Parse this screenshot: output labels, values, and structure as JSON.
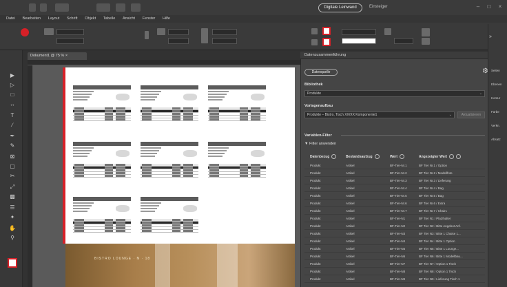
{
  "app": {
    "cloud_button": "Digitale Leinwand",
    "workspace": "Einsteiger"
  },
  "menu": [
    "Datei",
    "Bearbeiten",
    "Layout",
    "Schrift",
    "Objekt",
    "Tabelle",
    "Ansicht",
    "Fenster",
    "Hilfe"
  ],
  "document": {
    "tab_label": "Dokument1 @ 75 % ×"
  },
  "page": {
    "photo_caption": "BISTRO LOUNGE · N · 18"
  },
  "panel": {
    "title": "Datenzusammenführung",
    "action_button": "Datenquelle",
    "source_label": "Bibliothek",
    "source_value": "Produkte",
    "template_label": "Vorlagenaufbau",
    "template_value": "Produkte – Bistro, Tisch XX/XX Komponente1",
    "right_button": "Aktualisieren",
    "filter_label": "Variablen-Filter",
    "filter_toggle": "Filter anwenden",
    "columns": [
      "Datenbezug",
      "Bestandsaufzug",
      "Wert",
      "Angezeigter Wert"
    ],
    "rows": [
      [
        "Produkt",
        "Artikel",
        "BF-Tier-Nr.1",
        "BF Tier Nr.1 / Option"
      ],
      [
        "Produkt",
        "Artikel",
        "BF-Tier-Nr.2",
        "BF Tier Nr.2 / Modellfoto"
      ],
      [
        "Produkt",
        "Artikel",
        "BF-Tier-Nr.3",
        "BF Tier Nr.3 / Lieferung"
      ],
      [
        "Produkt",
        "Artikel",
        "BF-Tier-Nr.4",
        "BF Tier Nr.4 / Bag"
      ],
      [
        "Produkt",
        "Artikel",
        "BF-Tier-Nr.5",
        "BF Tier Nr.5 / Bag"
      ],
      [
        "Produkt",
        "Artikel",
        "BF-Tier-Nr.6",
        "BF Tier Nr.6 / Extra"
      ],
      [
        "Produkt",
        "Artikel",
        "BF-Tier-Nr.7",
        "BF Tier Nr.7 / Chair1"
      ],
      [
        "Produkt",
        "Artikel",
        "BF-Tier-N1",
        "BF Tier N1 / Platzhalter"
      ],
      [
        "Produkt",
        "Artikel",
        "BF-Tier-N2",
        "BF Tier N2 / Bitte Angebot Anf."
      ],
      [
        "Produkt",
        "Artikel",
        "BF-Tier-N3",
        "BF Tier N3 / Bitte 1 Chaise 1..."
      ],
      [
        "Produkt",
        "Artikel",
        "BF-Tier-N4",
        "BF Tier N4 / Bitte 1 Option"
      ],
      [
        "Produkt",
        "Artikel",
        "BF-Tier-N5",
        "BF Tier N5 / Bitte 1 Lounge..."
      ],
      [
        "Produkt",
        "Artikel",
        "BF-Tier-N6",
        "BF Tier N6 / Bitte 1 Modellbau..."
      ],
      [
        "Produkt",
        "Artikel",
        "BF-Tier-N7",
        "BF Tier N7 / Option 1 Tisch"
      ],
      [
        "Produkt",
        "Artikel",
        "BF-Tier-N8",
        "BF Tier N8 / Option 1 Tisch"
      ],
      [
        "Produkt",
        "Artikel",
        "BF-Tier-N9",
        "BF Tier N9 / Lieferung Tisch 1"
      ]
    ]
  },
  "rail": [
    "Seiten",
    "Ebenen",
    "Kontur",
    "Farbe",
    "Verkn.",
    "Absatz"
  ],
  "icons": {
    "accent": "#d62027"
  }
}
